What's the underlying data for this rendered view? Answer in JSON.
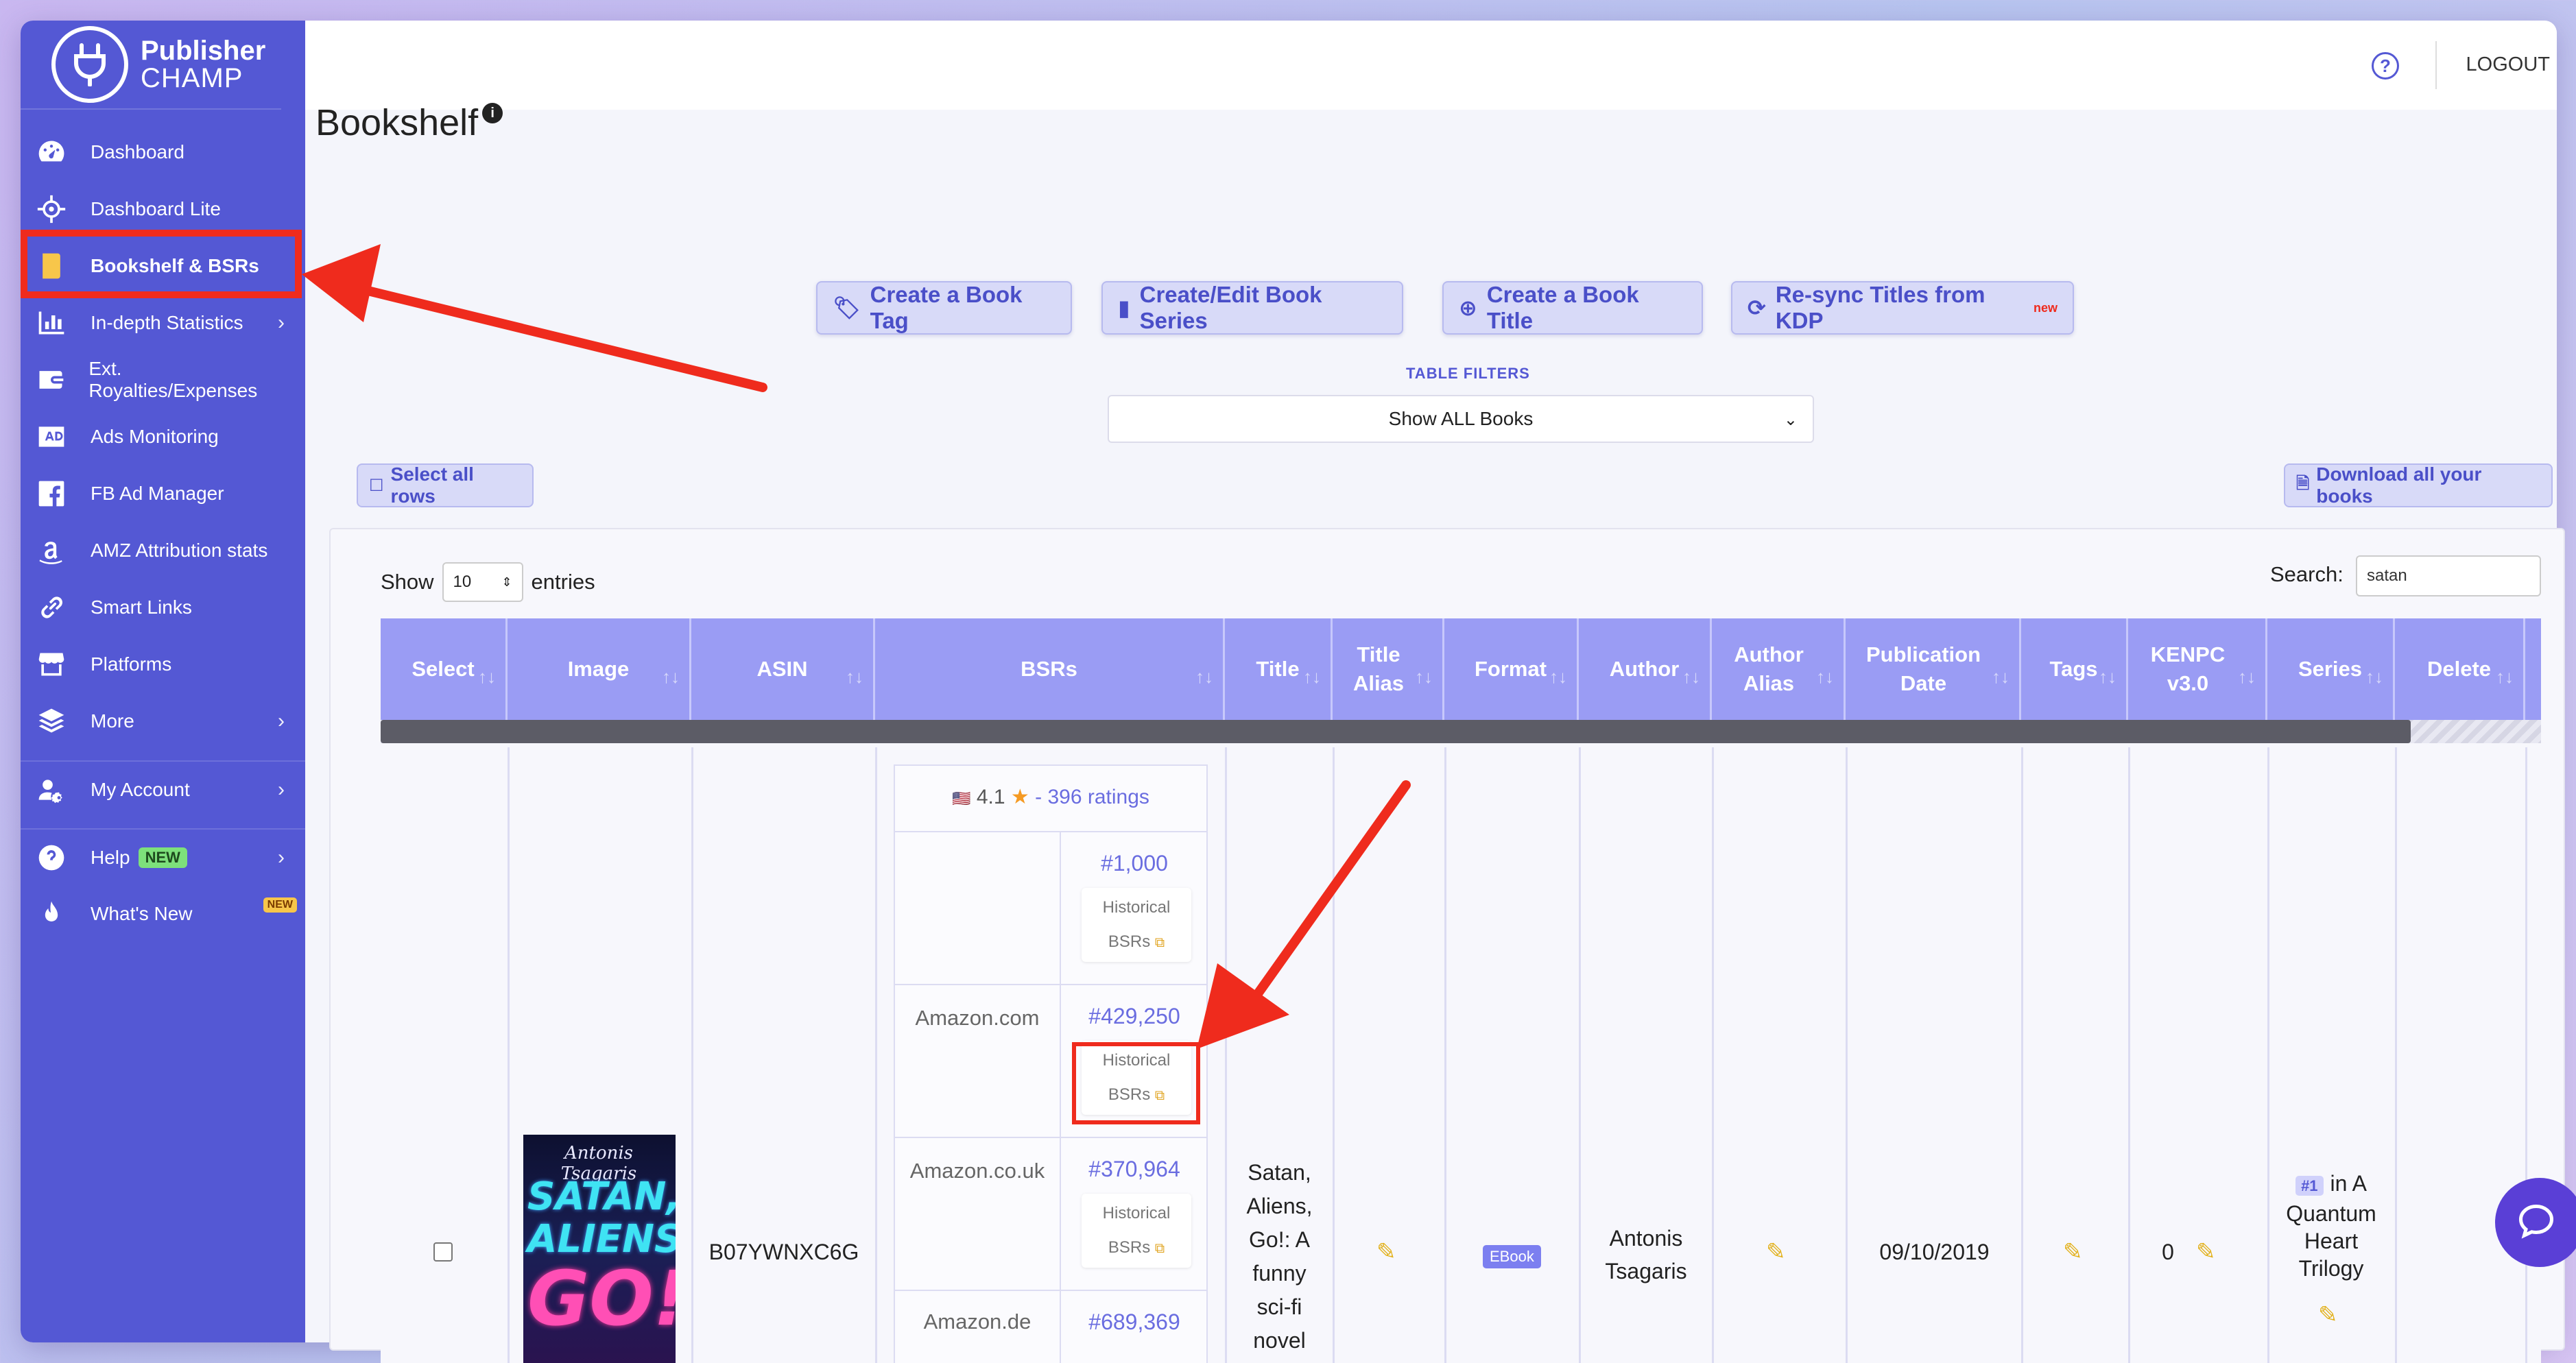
{
  "brand": {
    "name1": "Publisher",
    "name2": "CHAMP"
  },
  "sidebar": {
    "items": [
      {
        "label": "Dashboard",
        "icon": "gauge-icon"
      },
      {
        "label": "Dashboard Lite",
        "icon": "crosshair-icon"
      },
      {
        "label": "Bookshelf & BSRs",
        "icon": "book-icon",
        "active": true
      },
      {
        "label": "In-depth Statistics",
        "icon": "bar-chart-icon"
      },
      {
        "label": "Ext. Royalties/Expenses",
        "icon": "wallet-icon"
      },
      {
        "label": "Ads Monitoring",
        "icon": "ad-icon"
      },
      {
        "label": "FB Ad Manager",
        "icon": "facebook-icon"
      },
      {
        "label": "AMZ Attribution stats",
        "icon": "amazon-icon"
      },
      {
        "label": "Smart Links",
        "icon": "link-icon"
      },
      {
        "label": "Platforms",
        "icon": "store-icon"
      },
      {
        "label": "More",
        "icon": "layers-icon"
      },
      {
        "label": "My Account",
        "icon": "user-gear-icon"
      },
      {
        "label": "Help",
        "icon": "question-icon",
        "badge": "NEW"
      },
      {
        "label": "What's New",
        "icon": "fire-icon",
        "badge": "NEW"
      }
    ]
  },
  "topbar": {
    "logout": "LOGOUT"
  },
  "page": {
    "title": "Bookshelf"
  },
  "actions": {
    "create_tag": "Create a Book Tag",
    "edit_series": "Create/Edit Book Series",
    "create_title": "Create a Book Title",
    "resync": "Re-sync Titles from KDP",
    "resync_badge": "new"
  },
  "filters": {
    "label": "TABLE FILTERS",
    "selected": "Show ALL Books"
  },
  "select_all": "Select all rows",
  "download": "Download all your books",
  "entries": {
    "show": "Show",
    "value": "10",
    "suffix": "entries"
  },
  "search": {
    "label": "Search:",
    "value": "satan"
  },
  "table": {
    "headers": [
      "Select",
      "Image",
      "ASIN",
      "BSRs",
      "Title",
      "Title Alias",
      "Format",
      "Author",
      "Author Alias",
      "Publication Date",
      "Tags",
      "KENPC v3.0",
      "Series",
      "Delete"
    ],
    "row": {
      "asin": "B07YWNXC6G",
      "rating_value": "4.1",
      "rating_count": "- 396 ratings",
      "bsrs": [
        {
          "market": "",
          "rank": "#1,000"
        },
        {
          "market": "Amazon.com",
          "rank": "#429,250"
        },
        {
          "market": "Amazon.co.uk",
          "rank": "#370,964"
        },
        {
          "market": "Amazon.de",
          "rank": "#689,369"
        }
      ],
      "historical_label_1": "Historical",
      "historical_label_2": "BSRs",
      "title_lines": [
        "Satan,",
        "Aliens,",
        "Go!: A",
        "funny",
        "sci-fi",
        "novel"
      ],
      "format": "EBook",
      "author_lines": [
        "Antonis",
        "Tsagaris"
      ],
      "publication_date": "09/10/2019",
      "kenpc": "0",
      "series_rank": "#1",
      "series_lines": [
        "in A",
        "Quantum",
        "Heart",
        "Trilogy"
      ],
      "cover_author": "Antonis Tsagaris",
      "cover_title_1": "SATAN,",
      "cover_title_2": "ALIENS",
      "cover_title_3": "GO!"
    }
  },
  "colors": {
    "sidebar": "#5458d4",
    "accent": "#9a9cf4",
    "annotation": "#ef2b1d"
  }
}
